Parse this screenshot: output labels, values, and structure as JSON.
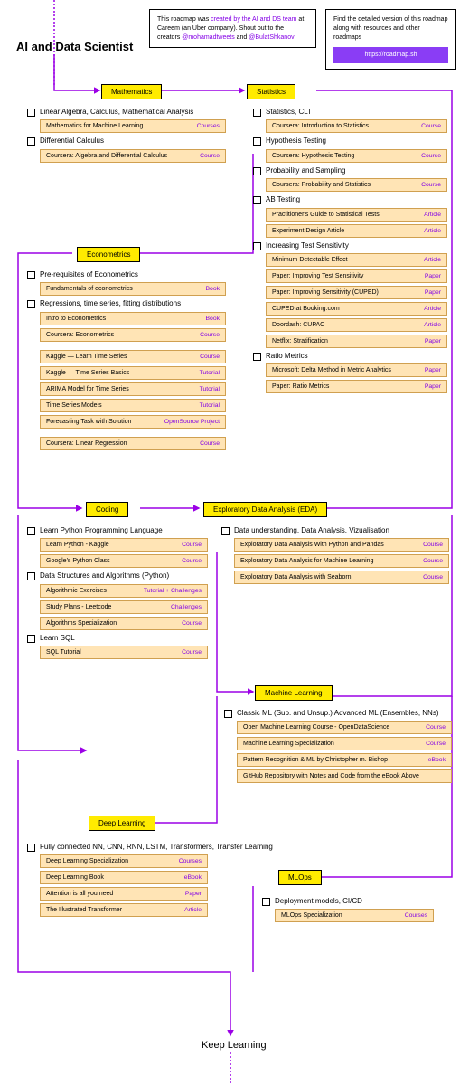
{
  "title": "AI and Data Scientist",
  "info1": {
    "pre": "This roadmap was ",
    "link1": "created by the AI and DS team",
    "mid": " at Careem (an Uber company). Shout out to the creators ",
    "h1": "@mohamadtweets",
    "and": " and ",
    "h2": "@BulatShkanov"
  },
  "info2": {
    "text": "Find the detailed version of this roadmap along with resources and other roadmaps",
    "btn": "https://roadmap.sh"
  },
  "sections": {
    "math": "Mathematics",
    "stats": "Statistics",
    "econ": "Econometrics",
    "coding": "Coding",
    "eda": "Exploratory Data Analysis (EDA)",
    "ml": "Machine Learning",
    "dl": "Deep Learning",
    "mlops": "MLOps"
  },
  "topics": {
    "math1": "Linear Algebra, Calculus, Mathematical Analysis",
    "math2": "Differential Calculus",
    "stats1": "Statistics, CLT",
    "stats2": "Hypothesis Testing",
    "stats3": "Probability and Sampling",
    "stats4": "AB Testing",
    "stats5": "Increasing Test Sensitivity",
    "stats6": "Ratio Metrics",
    "econ1": "Pre-requisites of Econometrics",
    "econ2": "Regressions, time series, fitting distributions",
    "code1": "Learn Python Programming Language",
    "code2": "Data Structures and Algorithms (Python)",
    "code3": "Learn SQL",
    "eda1": "Data understanding, Data Analysis, Vizualisation",
    "ml1": "Classic ML (Sup. and Unsup.) Advanced ML (Ensembles, NNs)",
    "dl1": "Fully connected NN, CNN, RNN, LSTM, Transformers, Transfer Learning",
    "mlops1": "Deployment models, CI/CD"
  },
  "res": {
    "m1": {
      "n": "Mathematics for Machine Learning",
      "t": "Courses"
    },
    "m2": {
      "n": "Coursera: Algebra and Differential Calculus",
      "t": "Course"
    },
    "s1": {
      "n": "Coursera: Introduction to Statistics",
      "t": "Course"
    },
    "s2": {
      "n": "Coursera: Hypothesis Testing",
      "t": "Course"
    },
    "s3": {
      "n": "Coursera: Probability and Statistics",
      "t": "Course"
    },
    "s4a": {
      "n": "Practitioner's Guide to Statistical Tests",
      "t": "Article"
    },
    "s4b": {
      "n": "Experiment Design Article",
      "t": "Article"
    },
    "s5a": {
      "n": "Minimum Detectable Effect",
      "t": "Article"
    },
    "s5b": {
      "n": "Paper: Improving Test Sensitivity",
      "t": "Paper"
    },
    "s5c": {
      "n": "Paper: Improving Sensitivity (CUPED)",
      "t": "Paper"
    },
    "s5d": {
      "n": "CUPED at Booking.com",
      "t": "Article"
    },
    "s5e": {
      "n": "Doordash: CUPAC",
      "t": "Article"
    },
    "s5f": {
      "n": "Netflix: Stratification",
      "t": "Paper"
    },
    "s6a": {
      "n": "Microsoft: Delta Method in Metric Analytics",
      "t": "Paper"
    },
    "s6b": {
      "n": "Paper: Ratio Metrics",
      "t": "Paper"
    },
    "e1": {
      "n": "Fundamentals of econometrics",
      "t": "Book"
    },
    "e2a": {
      "n": "Intro to Econometrics",
      "t": "Book"
    },
    "e2b": {
      "n": "Coursera: Econometrics",
      "t": "Course"
    },
    "e2c": {
      "n": "Kaggle — Learn Time Series",
      "t": "Course"
    },
    "e2d": {
      "n": "Kaggle — Time Series Basics",
      "t": "Tutorial"
    },
    "e2e": {
      "n": "ARIMA Model for Time Series",
      "t": "Tutorial"
    },
    "e2f": {
      "n": "Time Series Models",
      "t": "Tutorial"
    },
    "e2g": {
      "n": "Forecasting Task with Solution",
      "t": "OpenSource Project"
    },
    "e2h": {
      "n": "Coursera: Linear Regression",
      "t": "Course"
    },
    "c1a": {
      "n": "Learn Python - Kaggle",
      "t": "Course"
    },
    "c1b": {
      "n": "Google's Python Class",
      "t": "Course"
    },
    "c2a": {
      "n": "Algorithmic Exercises",
      "t": "Tutorial + Challenges"
    },
    "c2b": {
      "n": "Study Plans - Leetcode",
      "t": "Challenges"
    },
    "c2c": {
      "n": "Algorithms Specialization",
      "t": "Course"
    },
    "c3": {
      "n": "SQL Tutorial",
      "t": "Course"
    },
    "ed1": {
      "n": "Exploratory Data Analysis With Python and Pandas",
      "t": "Course"
    },
    "ed2": {
      "n": "Exploratory Data Analysis for Machine Learning",
      "t": "Course"
    },
    "ed3": {
      "n": "Exploratory Data Analysis with Seaborn",
      "t": "Course"
    },
    "ml1": {
      "n": "Open Machine Learning Course - OpenDataScience",
      "t": "Course"
    },
    "ml2": {
      "n": "Machine Learning Specialization",
      "t": "Course"
    },
    "ml3": {
      "n": "Pattern Recognition & ML by Christopher m. Bishop",
      "t": "eBook"
    },
    "ml4": {
      "n": "GitHub Repository with Notes and Code from the eBook Above",
      "t": ""
    },
    "dl1": {
      "n": "Deep Learning Specialization",
      "t": "Courses"
    },
    "dl2": {
      "n": "Deep Learning Book",
      "t": "eBook"
    },
    "dl3": {
      "n": "Attention is all you need",
      "t": "Paper"
    },
    "dl4": {
      "n": "The Illustrated Transformer",
      "t": "Article"
    },
    "mo1": {
      "n": "MLOps Specialization",
      "t": "Courses"
    }
  },
  "keep": "Keep Learning"
}
